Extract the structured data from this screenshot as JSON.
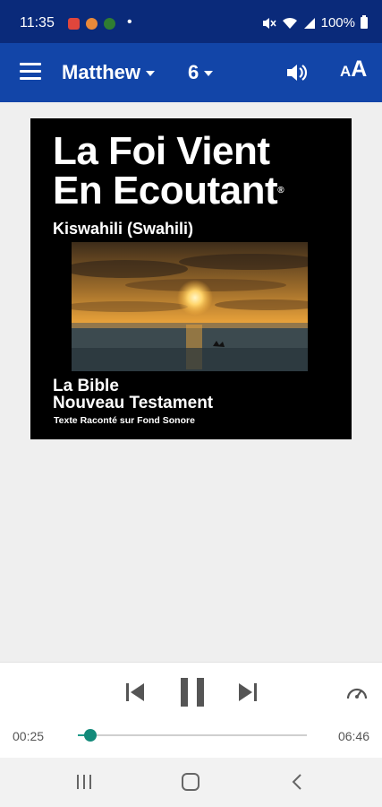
{
  "status_bar": {
    "time": "11:35",
    "battery": "100%",
    "notification_colors": [
      "#e0463c",
      "#e8893a",
      "#2f7d32"
    ]
  },
  "toolbar": {
    "book": "Matthew",
    "chapter": "6",
    "background": "#1245a8",
    "status_background": "#0a2a7a",
    "text_size_small": "A",
    "text_size_big": "A"
  },
  "cover": {
    "title_line1": "La Foi Vient",
    "title_line2": "En Ecoutant",
    "registered": "®",
    "language": "Kiswahili (Swahili)",
    "bible_line1": "La Bible",
    "bible_line2": "Nouveau Testament",
    "tagline": "Texte Raconté sur Fond Sonore"
  },
  "player": {
    "elapsed": "00:25",
    "duration": "06:46",
    "progress_fraction": 0.055,
    "accent": "#138a7a"
  },
  "icons": {
    "menu": "menu-icon",
    "speaker": "speaker-icon",
    "text_size": "text-size-icon",
    "previous": "skip-previous-icon",
    "pause": "pause-icon",
    "next": "skip-next-icon",
    "speed": "speedometer-icon",
    "recents": "recents-icon",
    "home": "home-icon",
    "back": "back-icon"
  }
}
